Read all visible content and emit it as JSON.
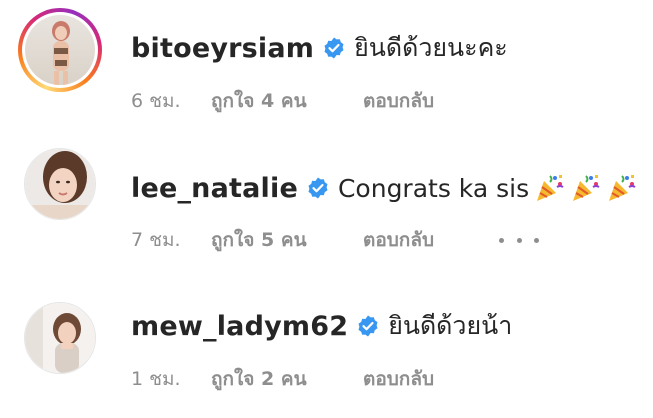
{
  "colors": {
    "text_primary": "#262626",
    "text_secondary": "#8e8e8e",
    "verified_blue": "#3897f0"
  },
  "comments": [
    {
      "username": "bitoeyrsiam",
      "verified": true,
      "avatar_icon": "profile-photo",
      "has_story_ring": true,
      "text": "ยินดีด้วยนะคะ",
      "emojis": [],
      "time": "6 ชม.",
      "likes": "ถูกใจ 4 คน",
      "reply": "ตอบกลับ",
      "show_more": false
    },
    {
      "username": "lee_natalie",
      "verified": true,
      "avatar_icon": "profile-photo",
      "has_story_ring": false,
      "text": "Congrats ka sis",
      "emojis": [
        "party-popper-icon",
        "party-popper-icon",
        "party-popper-icon"
      ],
      "time": "7 ชม.",
      "likes": "ถูกใจ 5 คน",
      "reply": "ตอบกลับ",
      "show_more": true
    },
    {
      "username": "mew_ladym62",
      "verified": true,
      "avatar_icon": "profile-photo",
      "has_story_ring": false,
      "text": "ยินดีด้วยน้า",
      "emojis": [],
      "time": "1 ชม.",
      "likes": "ถูกใจ 2 คน",
      "reply": "ตอบกลับ",
      "show_more": false
    }
  ]
}
